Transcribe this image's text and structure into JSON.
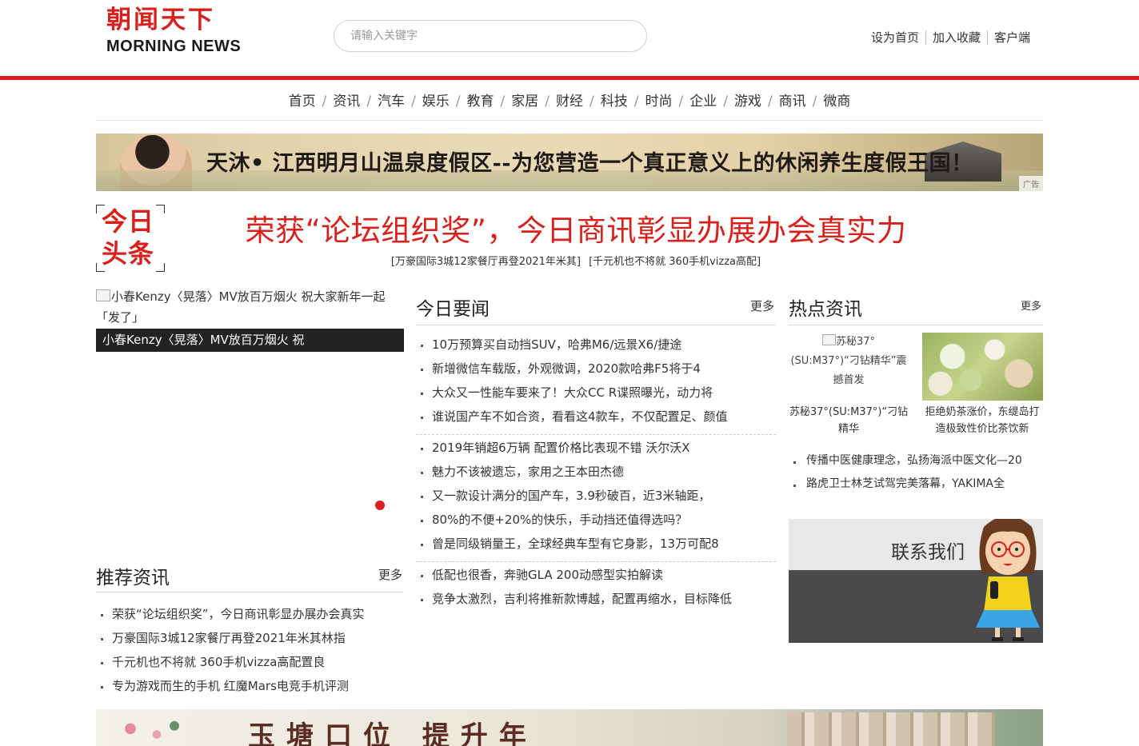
{
  "header": {
    "logo_cn": "朝闻天下",
    "logo_en": "MORNING NEWS",
    "search_placeholder": "请输入关键字",
    "links": [
      "设为首页",
      "加入收藏",
      "客户端"
    ],
    "brand_color": "#d8211c"
  },
  "nav": {
    "items": [
      "首页",
      "资讯",
      "汽车",
      "娱乐",
      "教育",
      "家居",
      "财经",
      "科技",
      "时尚",
      "企业",
      "游戏",
      "商讯",
      "微商"
    ],
    "separator": "/"
  },
  "banner_ad": {
    "text": "天沐• 江西明月山温泉度假区--为您营造一个真正意义上的休闲养生度假王国！",
    "tag": "广告"
  },
  "headline": {
    "badge_line1": "今日",
    "badge_line2": "头条",
    "title": "荣获“论坛组织奖”，今日商讯彰显办展办会真实力",
    "sub_links": [
      "[万豪国际3城12家餐厅再登2021年米其]",
      "[千元机也不将就 360手机vizza高配]"
    ]
  },
  "slideshow": {
    "alt_text": "小春Kenzy〈晃落〉MV放百万烟火 祝大家新年一起「发了」",
    "caption": "小春Kenzy〈晃落〉MV放百万烟火 祝"
  },
  "recommend": {
    "title": "推荐资讯",
    "more": "更多",
    "items": [
      "荣获“论坛组织奖”，今日商讯彰显办展办会真实",
      "万豪国际3城12家餐厅再登2021年米其林指",
      "千元机也不将就 360手机vizza高配置良",
      "专为游戏而生的手机 红魔Mars电竞手机评测"
    ]
  },
  "today_news": {
    "title": "今日要闻",
    "more": "更多",
    "group1": [
      "10万预算买自动挡SUV，哈弗M6/远景X6/捷途",
      "新增微信车载版，外观微调，2020款哈弗F5将于4",
      "大众又一性能车要来了！大众CC R谍照曝光，动力将",
      "谁说国产车不如合资，看看这4款车，不仅配置足、颜值"
    ],
    "group2": [
      "2019年销超6万辆 配置价格比表现不错 沃尔沃X",
      "魅力不该被遗忘，家用之王本田杰德",
      "又一款设计满分的国产车，3.9秒破百，近3米轴距，",
      "80%的不便+20%的快乐，手动挡还值得选吗？",
      "曾是同级销量王，全球经典车型有它身影，13万可配8"
    ],
    "group3": [
      "低配也很香，奔驰GLA 200动感型实拍解读",
      "竞争太激烈，吉利将推新款博越，配置再缩水，目标降低"
    ]
  },
  "hot_news": {
    "title": "热点资讯",
    "more": "更多",
    "thumb1_alt": "苏秘37°(SU:M37°)“刁钻精华”震撼首发",
    "thumb1_caption": "苏秘37°(SU:M37°)“刁钻精华",
    "thumb2_caption": "拒绝奶茶涨价，东缇岛打造极致性价比茶饮新",
    "items": [
      "传播中医健康理念，弘扬海派中医文化—20",
      "路虎卫士林芝试驾完美落幕，YAKIMA全"
    ]
  },
  "contact": {
    "label": "联系我们"
  },
  "bottom_banner": {
    "text": "玉塘口位 提升年"
  }
}
